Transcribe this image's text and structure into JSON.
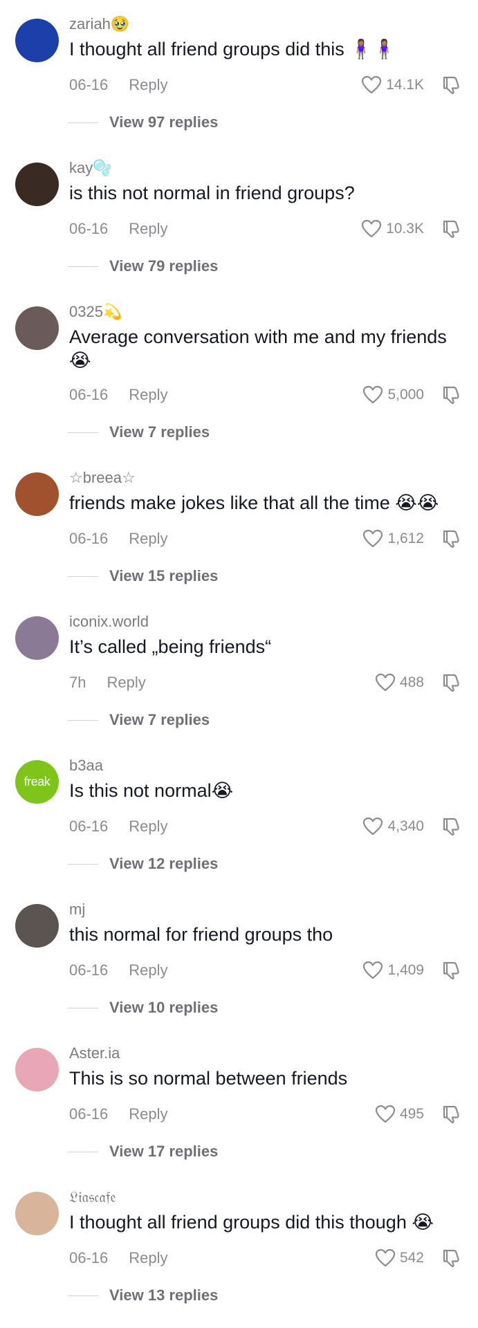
{
  "comments": [
    {
      "username": "zariah🥹",
      "text": "I thought all friend groups did this 🧍🏽‍♀️🧍🏽‍♀️",
      "date": "06-16",
      "reply_label": "Reply",
      "likes": "14.1K",
      "view_replies": "View 97 replies",
      "avatar_color": "#1d3fa8"
    },
    {
      "username": "kay🫧",
      "text": "is this not normal in friend groups?",
      "date": "06-16",
      "reply_label": "Reply",
      "likes": "10.3K",
      "view_replies": "View 79 replies",
      "avatar_color": "#3a2a24"
    },
    {
      "username": "0325💫",
      "text": "Average conversation with me and my friends 😭",
      "date": "06-16",
      "reply_label": "Reply",
      "likes": "5,000",
      "view_replies": "View 7 replies",
      "avatar_color": "#6b5a5a"
    },
    {
      "username": "☆breea☆",
      "text": "friends make jokes like that all the time 😭😭",
      "date": "06-16",
      "reply_label": "Reply",
      "likes": "1,612",
      "view_replies": "View 15 replies",
      "avatar_color": "#a0522d"
    },
    {
      "username": "iconix.world",
      "text": "It’s called „being friends“",
      "date": "7h",
      "reply_label": "Reply",
      "likes": "488",
      "view_replies": "View 7 replies",
      "avatar_color": "#8a7a95"
    },
    {
      "username": "b3aa",
      "text": "Is this not normal😭",
      "date": "06-16",
      "reply_label": "Reply",
      "likes": "4,340",
      "view_replies": "View 12 replies",
      "avatar_color": "#7fc41a",
      "avatar_text": "freak"
    },
    {
      "username": "mj",
      "text": "this normal for friend groups tho",
      "date": "06-16",
      "reply_label": "Reply",
      "likes": "1,409",
      "view_replies": "View 10 replies",
      "avatar_color": "#5b5552"
    },
    {
      "username": "Aster.ia",
      "text": "This is so normal between friends",
      "date": "06-16",
      "reply_label": "Reply",
      "likes": "495",
      "view_replies": "View 17 replies",
      "avatar_color": "#e7a7b7"
    },
    {
      "username": "𝔏𝔦𝔞𝔰𝔠𝔞𝔣𝔢",
      "text": "I thought all friend groups did this though 😭",
      "date": "06-16",
      "reply_label": "Reply",
      "likes": "542",
      "view_replies": "View 13 replies",
      "avatar_color": "#d8b49a"
    }
  ],
  "icons": {
    "like": "heart-outline-icon",
    "dislike": "thumbs-down-outline-icon"
  }
}
